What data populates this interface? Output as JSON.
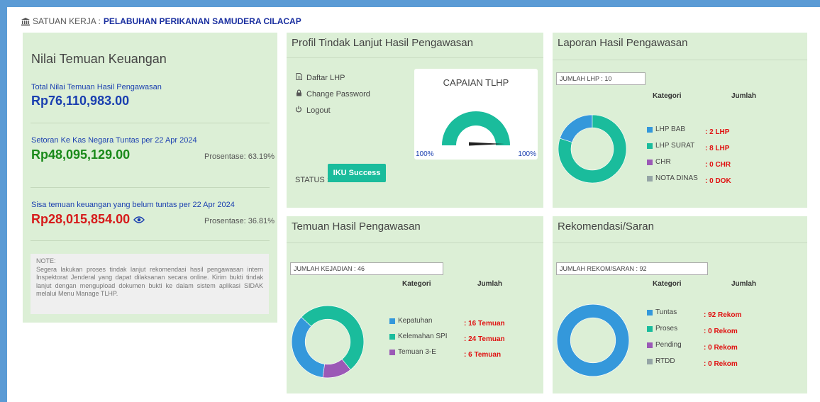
{
  "header": {
    "prefix": "SATUAN KERJA :",
    "unit_name": "PELABUHAN PERIKANAN SAMUDERA CILACAP"
  },
  "finance": {
    "title": "Nilai Temuan Keuangan",
    "total_label": "Total Nilai Temuan Hasil Pengawasan",
    "total_amount": "Rp76,110,983.00",
    "paid_label": "Setoran Ke Kas Negara Tuntas per 22 Apr 2024",
    "paid_amount": "Rp48,095,129.00",
    "paid_pct": "Prosentase: 63.19%",
    "remaining_label": "Sisa temuan keuangan yang belum tuntas per 22 Apr 2024",
    "remaining_amount": "Rp28,015,854.00",
    "remaining_pct": "Prosentase: 36.81%",
    "note": "NOTE:\nSegera lakukan proses tindak lanjut rekomendasi hasil pengawasan intern Inspektorat Jenderal yang dapat dilaksanan secara online. Kirim bukti tindak lanjut dengan mengupload dokumen bukti ke dalam sistem aplikasi SIDAK melalui Menu Manage TLHP.",
    "colors": {
      "total": "#1a3fb0",
      "paid": "#1a8a1a",
      "remaining": "#d61a1a"
    }
  },
  "profil": {
    "title": "Profil Tindak Lanjut Hasil Pengawasan",
    "menu": [
      {
        "label": "Daftar LHP",
        "icon": "document-icon"
      },
      {
        "label": "Change Password",
        "icon": "lock-icon"
      },
      {
        "label": "Logout",
        "icon": "power-icon"
      }
    ],
    "gauge": {
      "title": "CAPAIAN TLHP",
      "value_pct": 100,
      "left_label": "100%",
      "right_label": "100%",
      "color": "#1abc9c"
    },
    "status_label": "STATUS :",
    "status_value": "IKU Success"
  },
  "laporan": {
    "title": "Laporan Hasil Pengawasan",
    "count": "JUMLAH LHP : 10",
    "col_kategori": "Kategori",
    "col_jumlah": "Jumlah",
    "items": [
      {
        "label": "LHP BAB",
        "value": ": 2 LHP",
        "n": 2,
        "color": "#3498db"
      },
      {
        "label": "LHP SURAT",
        "value": ": 8 LHP",
        "n": 8,
        "color": "#1abc9c"
      },
      {
        "label": "CHR",
        "value": ": 0 CHR",
        "n": 0,
        "color": "#9b59b6"
      },
      {
        "label": "NOTA DINAS",
        "value": ": 0 DOK",
        "n": 0,
        "color": "#95a5a6"
      }
    ]
  },
  "temuan": {
    "title": "Temuan Hasil Pengawasan",
    "count": "JUMLAH KEJADIAN : 46",
    "col_kategori": "Kategori",
    "col_jumlah": "Jumlah",
    "items": [
      {
        "label": "Kepatuhan",
        "value": ": 16 Temuan",
        "n": 16,
        "color": "#3498db"
      },
      {
        "label": "Kelemahan SPI",
        "value": ": 24 Temuan",
        "n": 24,
        "color": "#1abc9c"
      },
      {
        "label": "Temuan 3-E",
        "value": ": 6 Temuan",
        "n": 6,
        "color": "#9b59b6"
      }
    ]
  },
  "rekom": {
    "title": "Rekomendasi/Saran",
    "count": "JUMLAH REKOM/SARAN : 92",
    "col_kategori": "Kategori",
    "col_jumlah": "Jumlah",
    "items": [
      {
        "label": "Tuntas",
        "value": ": 92 Rekom",
        "n": 92,
        "color": "#3498db"
      },
      {
        "label": "Proses",
        "value": ": 0 Rekom",
        "n": 0,
        "color": "#1abc9c"
      },
      {
        "label": "Pending",
        "value": ": 0 Rekom",
        "n": 0,
        "color": "#9b59b6"
      },
      {
        "label": "RTDD",
        "value": ": 0 Rekom",
        "n": 0,
        "color": "#95a5a6"
      }
    ]
  },
  "value_color": "#e01010"
}
